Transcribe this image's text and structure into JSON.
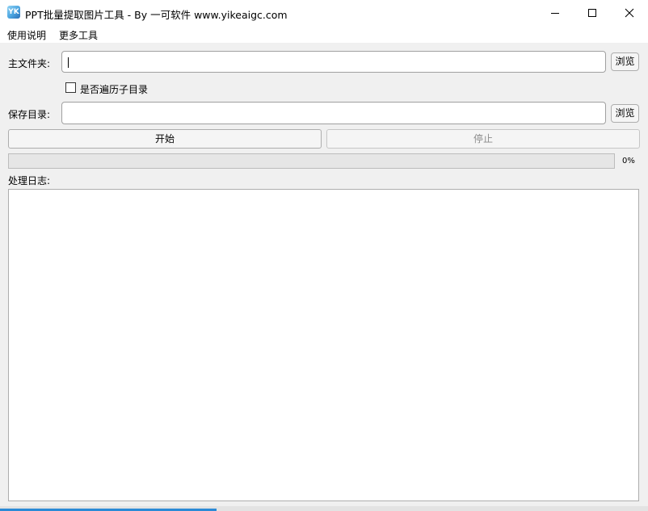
{
  "window": {
    "title": "PPT批量提取图片工具 - By 一可软件 www.yikeaigc.com",
    "app_icon_glyph": "YK",
    "controls": [
      "minimize-icon",
      "maximize-icon",
      "close-icon"
    ]
  },
  "menu": {
    "items": [
      {
        "label": "使用说明"
      },
      {
        "label": "更多工具"
      }
    ]
  },
  "form": {
    "main_folder_label": "主文件夹:",
    "main_folder_value": "",
    "browse_label": "浏览",
    "subdir_checkbox_label": "是否遍历子目录",
    "subdir_checked": false,
    "save_dir_label": "保存目录:",
    "save_dir_value": ""
  },
  "actions": {
    "start_label": "开始",
    "stop_label": "停止",
    "stop_enabled": false
  },
  "progress": {
    "value": 0,
    "text": "0%",
    "fill_color": "#06b025"
  },
  "log": {
    "label": "处理日志:",
    "content": ""
  }
}
